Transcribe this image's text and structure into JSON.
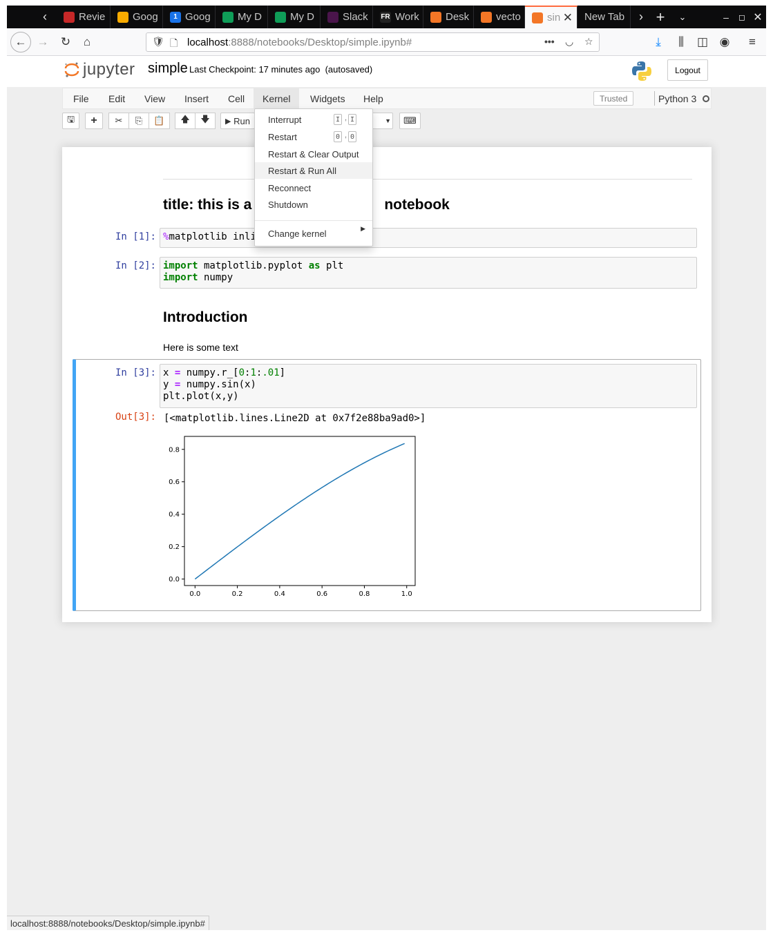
{
  "browser": {
    "tabs": [
      {
        "label": "Revie",
        "favicon": "review-icon",
        "color": "#c62828"
      },
      {
        "label": "Goog",
        "favicon": "google-keep-icon",
        "color": "#f9ab00"
      },
      {
        "label": "Goog",
        "favicon": "google-calendar-icon",
        "color": "#1a73e8",
        "fav_text": "1"
      },
      {
        "label": "My D",
        "favicon": "google-drive-icon",
        "color": "#0f9d58"
      },
      {
        "label": "My D",
        "favicon": "google-drive-icon",
        "color": "#0f9d58"
      },
      {
        "label": "Slack",
        "favicon": "slack-icon",
        "color": "#4a154b"
      },
      {
        "label": "Work",
        "favicon": "fr-icon",
        "color": "#222222",
        "fav_text": "FR"
      },
      {
        "label": "Desk",
        "favicon": "jupyter-icon",
        "color": "#f37626"
      },
      {
        "label": "vecto",
        "favicon": "notebook-icon",
        "color": "#f37626"
      },
      {
        "label": "sin",
        "favicon": "notebook-icon",
        "color": "#f37626",
        "active": true
      },
      {
        "label": "New Tab",
        "favicon": "",
        "color": ""
      }
    ],
    "url_host": "localhost",
    "url_rest": ":8888/notebooks/Desktop/simple.ipynb#",
    "status_url": "localhost:8888/notebooks/Desktop/simple.ipynb#"
  },
  "jupyter": {
    "logo_text": "jupyter",
    "notebook_name": "simple",
    "checkpoint": "Last Checkpoint: 17 minutes ago",
    "autosave": "(autosaved)",
    "logout_label": "Logout",
    "menus": [
      "File",
      "Edit",
      "View",
      "Insert",
      "Cell",
      "Kernel",
      "Widgets",
      "Help"
    ],
    "trusted_label": "Trusted",
    "kernel_name": "Python 3",
    "run_label": "Run"
  },
  "kernel_menu": {
    "items": [
      {
        "label": "Interrupt",
        "keys": [
          "I",
          "I"
        ]
      },
      {
        "label": "Restart",
        "keys": [
          "0",
          "0"
        ]
      },
      {
        "label": "Restart & Clear Output",
        "keys": []
      },
      {
        "label": "Restart & Run All",
        "keys": [],
        "hover": true
      },
      {
        "label": "Reconnect",
        "keys": []
      },
      {
        "label": "Shutdown",
        "keys": []
      }
    ],
    "change_kernel": "Change kernel"
  },
  "cells": {
    "title_pre": "title: this is a",
    "title_post": "notebook",
    "cell1_prompt": "In [1]:",
    "cell1_code_op": "%",
    "cell1_code": "matplotlib inli",
    "cell2_prompt": "In [2]:",
    "cell2_line1_kw": "import",
    "cell2_line1_mid": " matplotlib.pyplot ",
    "cell2_line1_kw2": "as",
    "cell2_line1_end": " plt",
    "cell2_line2_kw": "import",
    "cell2_line2_end": " numpy",
    "intro_heading": "Introduction",
    "intro_text": "Here is some text",
    "cell3_prompt": "In [3]:",
    "cell3_line1": "x = numpy.r_[0:1:.01]",
    "cell3_line2": "y = numpy.sin(x)",
    "cell3_line3": "plt.plot(x,y)",
    "out3_prompt": "Out[3]:",
    "out3_text": "[<matplotlib.lines.Line2D at 0x7f2e88ba9ad0>]"
  },
  "chart_data": {
    "type": "line",
    "series": [
      {
        "function": "sin(x)",
        "x_start": 0.0,
        "x_end": 0.99,
        "x_step": 0.01,
        "color": "#1f77b4"
      }
    ],
    "xlim": [
      -0.05,
      1.04
    ],
    "ylim": [
      -0.04,
      0.88
    ],
    "xticks": [
      "0.0",
      "0.2",
      "0.4",
      "0.6",
      "0.8",
      "1.0"
    ],
    "yticks": [
      "0.0",
      "0.2",
      "0.4",
      "0.6",
      "0.8"
    ],
    "grid": false
  }
}
